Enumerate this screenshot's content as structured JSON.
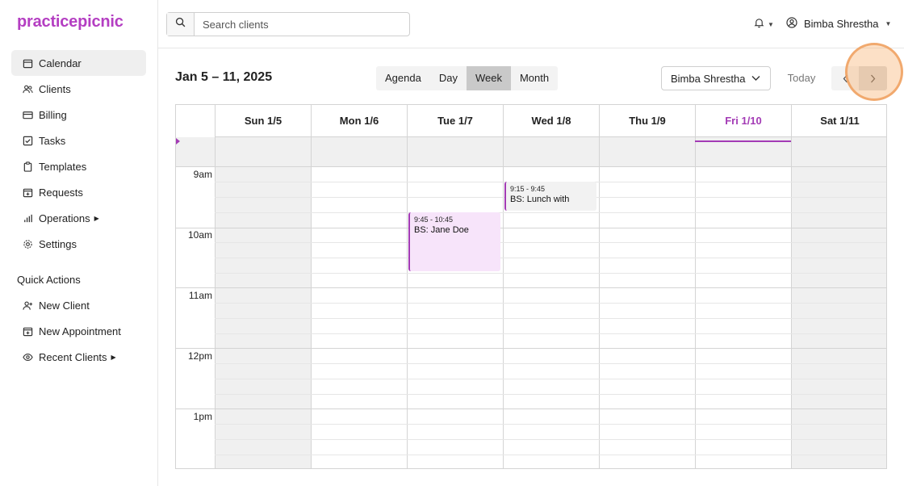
{
  "app": {
    "logo": "practicepicnic",
    "accent": "#a33bb5"
  },
  "sidebar": {
    "items": [
      {
        "label": "Calendar",
        "icon": "calendar-icon"
      },
      {
        "label": "Clients",
        "icon": "users-icon"
      },
      {
        "label": "Billing",
        "icon": "credit-card-icon"
      },
      {
        "label": "Tasks",
        "icon": "checkbox-icon"
      },
      {
        "label": "Templates",
        "icon": "clipboard-icon"
      },
      {
        "label": "Requests",
        "icon": "calendar-plus-icon"
      },
      {
        "label": "Operations",
        "icon": "bar-chart-icon"
      },
      {
        "label": "Settings",
        "icon": "gear-icon"
      }
    ],
    "quick_actions_title": "Quick Actions",
    "quick_actions": [
      {
        "label": "New Client",
        "icon": "user-plus-icon"
      },
      {
        "label": "New Appointment",
        "icon": "calendar-plus-icon"
      },
      {
        "label": "Recent Clients",
        "icon": "eye-icon"
      }
    ]
  },
  "header": {
    "search_placeholder": "Search clients",
    "user_name": "Bimba Shrestha"
  },
  "calendar": {
    "range_title": "Jan 5 – 11, 2025",
    "views": [
      "Agenda",
      "Day",
      "Week",
      "Month"
    ],
    "active_view": "Week",
    "provider": "Bimba Shrestha",
    "today_label": "Today",
    "days": [
      "Sun 1/5",
      "Mon 1/6",
      "Tue 1/7",
      "Wed 1/8",
      "Thu 1/9",
      "Fri 1/10",
      "Sat 1/11"
    ],
    "today_day": "Fri 1/10",
    "hours": [
      "9am",
      "10am",
      "11am",
      "12pm",
      "1pm"
    ],
    "events": [
      {
        "time": "9:45 - 10:45",
        "title": "BS: Jane Doe",
        "day": "Tue 1/7"
      },
      {
        "time": "9:15 - 9:45",
        "title": "BS: Lunch with",
        "day": "Wed 1/8"
      }
    ]
  }
}
